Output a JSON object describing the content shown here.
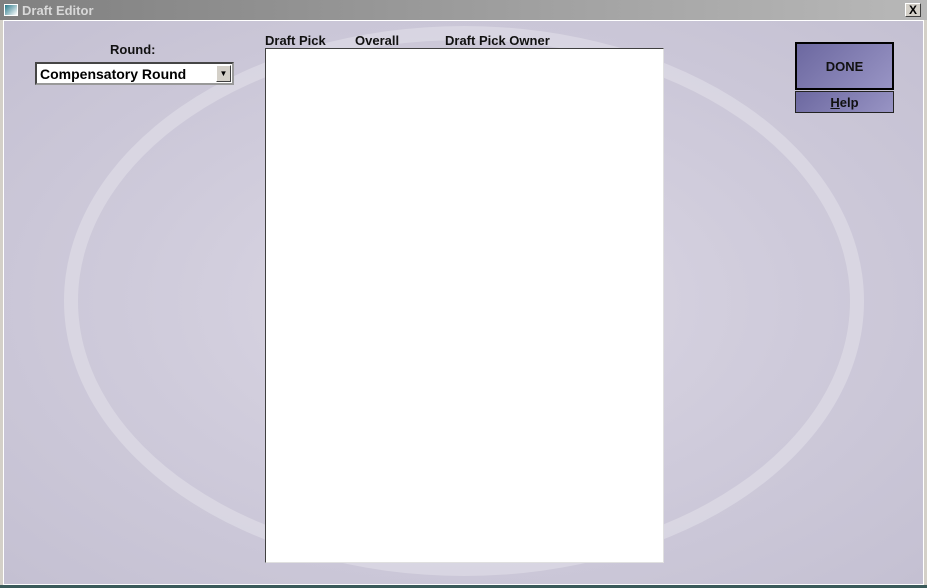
{
  "window": {
    "title": "Draft Editor",
    "close_label": "X"
  },
  "round": {
    "label": "Round:",
    "selected": "Compensatory Round"
  },
  "list": {
    "columns": [
      "Draft Pick",
      "Overall",
      "Draft Pick Owner"
    ],
    "rows": []
  },
  "buttons": {
    "done": "DONE",
    "help_underlined": "H",
    "help_rest": "elp"
  }
}
